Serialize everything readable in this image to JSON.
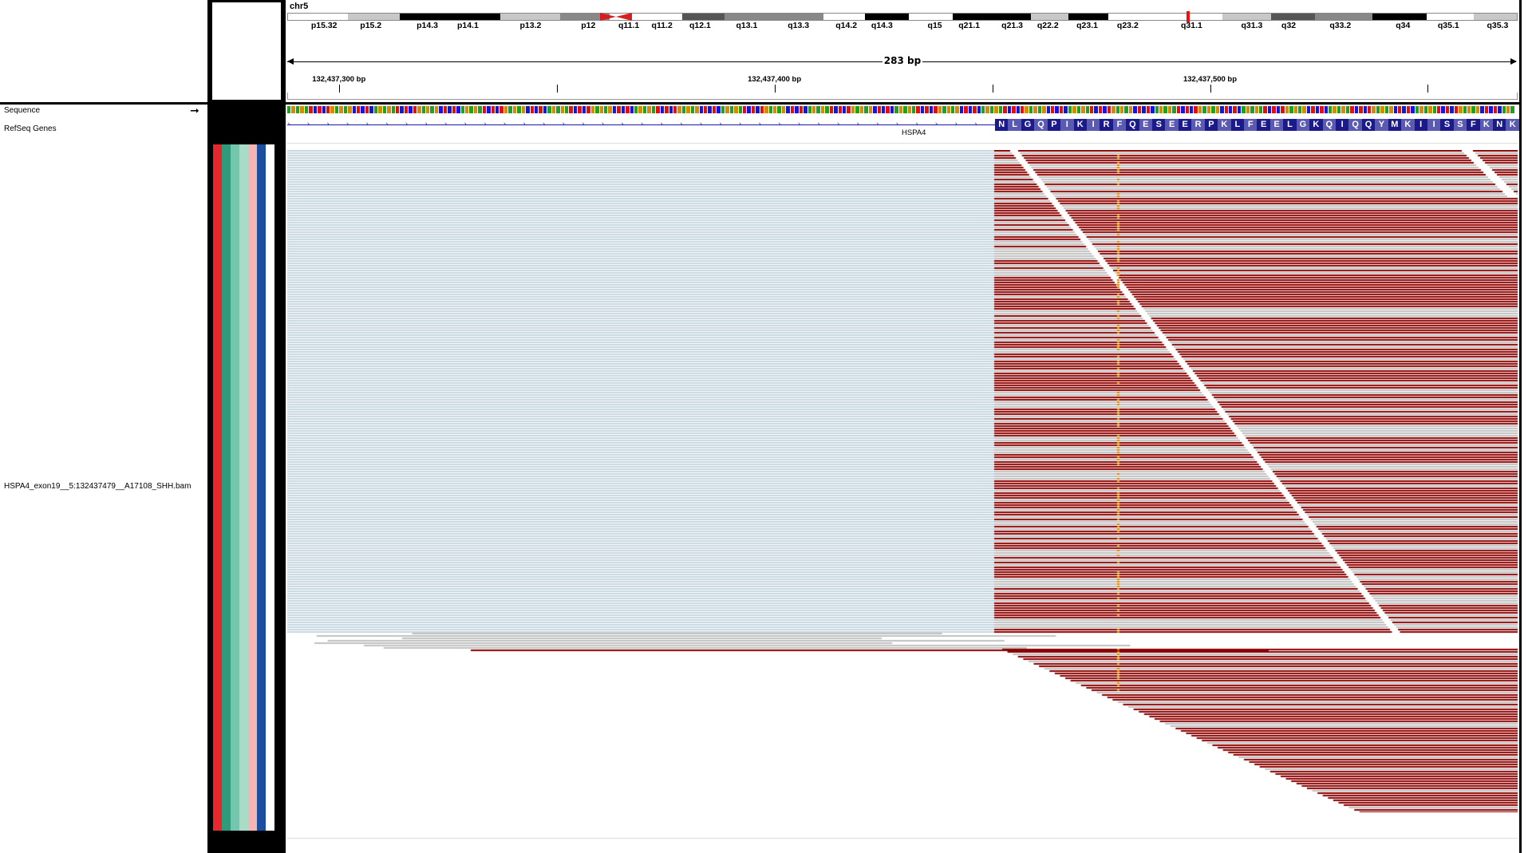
{
  "header": {
    "chromosome": "chr5",
    "span": "283 bp",
    "bands": [
      {
        "label": "p15.32",
        "pos": 0.03,
        "shade": "#fff"
      },
      {
        "label": "p15.2",
        "pos": 0.068,
        "shade": "#c8c8c8"
      },
      {
        "label": "p14.3",
        "pos": 0.114,
        "shade": "#000"
      },
      {
        "label": "p14.1",
        "pos": 0.147,
        "shade": "#000"
      },
      {
        "label": "p13.2",
        "pos": 0.198,
        "shade": "#c8c8c8"
      },
      {
        "label": "p12",
        "pos": 0.245,
        "shade": "#888"
      },
      {
        "label": "q11.1",
        "pos": 0.278,
        "shade": "#fff"
      },
      {
        "label": "q11.2",
        "pos": 0.305,
        "shade": "#fff"
      },
      {
        "label": "q12.1",
        "pos": 0.336,
        "shade": "#555"
      },
      {
        "label": "q13.1",
        "pos": 0.374,
        "shade": "#888"
      },
      {
        "label": "q13.3",
        "pos": 0.416,
        "shade": "#888"
      },
      {
        "label": "q14.2",
        "pos": 0.455,
        "shade": "#fff"
      },
      {
        "label": "q14.3",
        "pos": 0.484,
        "shade": "#000"
      },
      {
        "label": "q15",
        "pos": 0.527,
        "shade": "#fff"
      },
      {
        "label": "q21.1",
        "pos": 0.555,
        "shade": "#000"
      },
      {
        "label": "q21.3",
        "pos": 0.59,
        "shade": "#000"
      },
      {
        "label": "q22.2",
        "pos": 0.619,
        "shade": "#c8c8c8"
      },
      {
        "label": "q23.1",
        "pos": 0.651,
        "shade": "#000"
      },
      {
        "label": "q23.2",
        "pos": 0.684,
        "shade": "#fff"
      },
      {
        "label": "q31.1",
        "pos": 0.736,
        "shade": "#fff"
      },
      {
        "label": "q31.3",
        "pos": 0.785,
        "shade": "#c8c8c8"
      },
      {
        "label": "q32",
        "pos": 0.815,
        "shade": "#555"
      },
      {
        "label": "q33.2",
        "pos": 0.857,
        "shade": "#888"
      },
      {
        "label": "q34",
        "pos": 0.908,
        "shade": "#000"
      },
      {
        "label": "q35.1",
        "pos": 0.945,
        "shade": "#fff"
      },
      {
        "label": "q35.3",
        "pos": 0.985,
        "shade": "#c8c8c8"
      }
    ],
    "ruler": [
      {
        "label": "132,437,300 bp",
        "pos": 0.042
      },
      {
        "label": "132,437,400 bp",
        "pos": 0.396
      },
      {
        "label": "132,437,500 bp",
        "pos": 0.75
      }
    ],
    "minor_ticks": [
      0.219,
      0.573,
      0.927
    ]
  },
  "tracks": {
    "sequence": "Sequence",
    "refseq": "RefSeq Genes",
    "bam": "HSPA4_exon19__5:132437479__A17108_SHH.bam"
  },
  "gene": {
    "name": "HSPA4",
    "exon_start_fraction": 0.576,
    "amino_acids": [
      "N",
      "L",
      "G",
      "Q",
      "P",
      "I",
      "K",
      "I",
      "R",
      "F",
      "Q",
      "E",
      "S",
      "E",
      "E",
      "R",
      "P",
      "K",
      "L",
      "F",
      "E",
      "E",
      "L",
      "G",
      "K",
      "Q",
      "I",
      "Q",
      "Q",
      "Y",
      "M",
      "K",
      "I",
      "I",
      "S",
      "S",
      "F",
      "K",
      "N",
      "K"
    ]
  },
  "colors": {
    "read_red": "#8b0000",
    "read_gray": "#c0c0c0",
    "insertion_blue": "#c5d6e0",
    "gene_blue": "#1a1aa8",
    "mismatch_orange": "#d98200",
    "attr_colors": [
      "#e8262e",
      "#2e9b7b",
      "#74c5ab",
      "#a8dcc8",
      "#f4b5b5",
      "#1a4fa0",
      "#ffffff"
    ]
  }
}
